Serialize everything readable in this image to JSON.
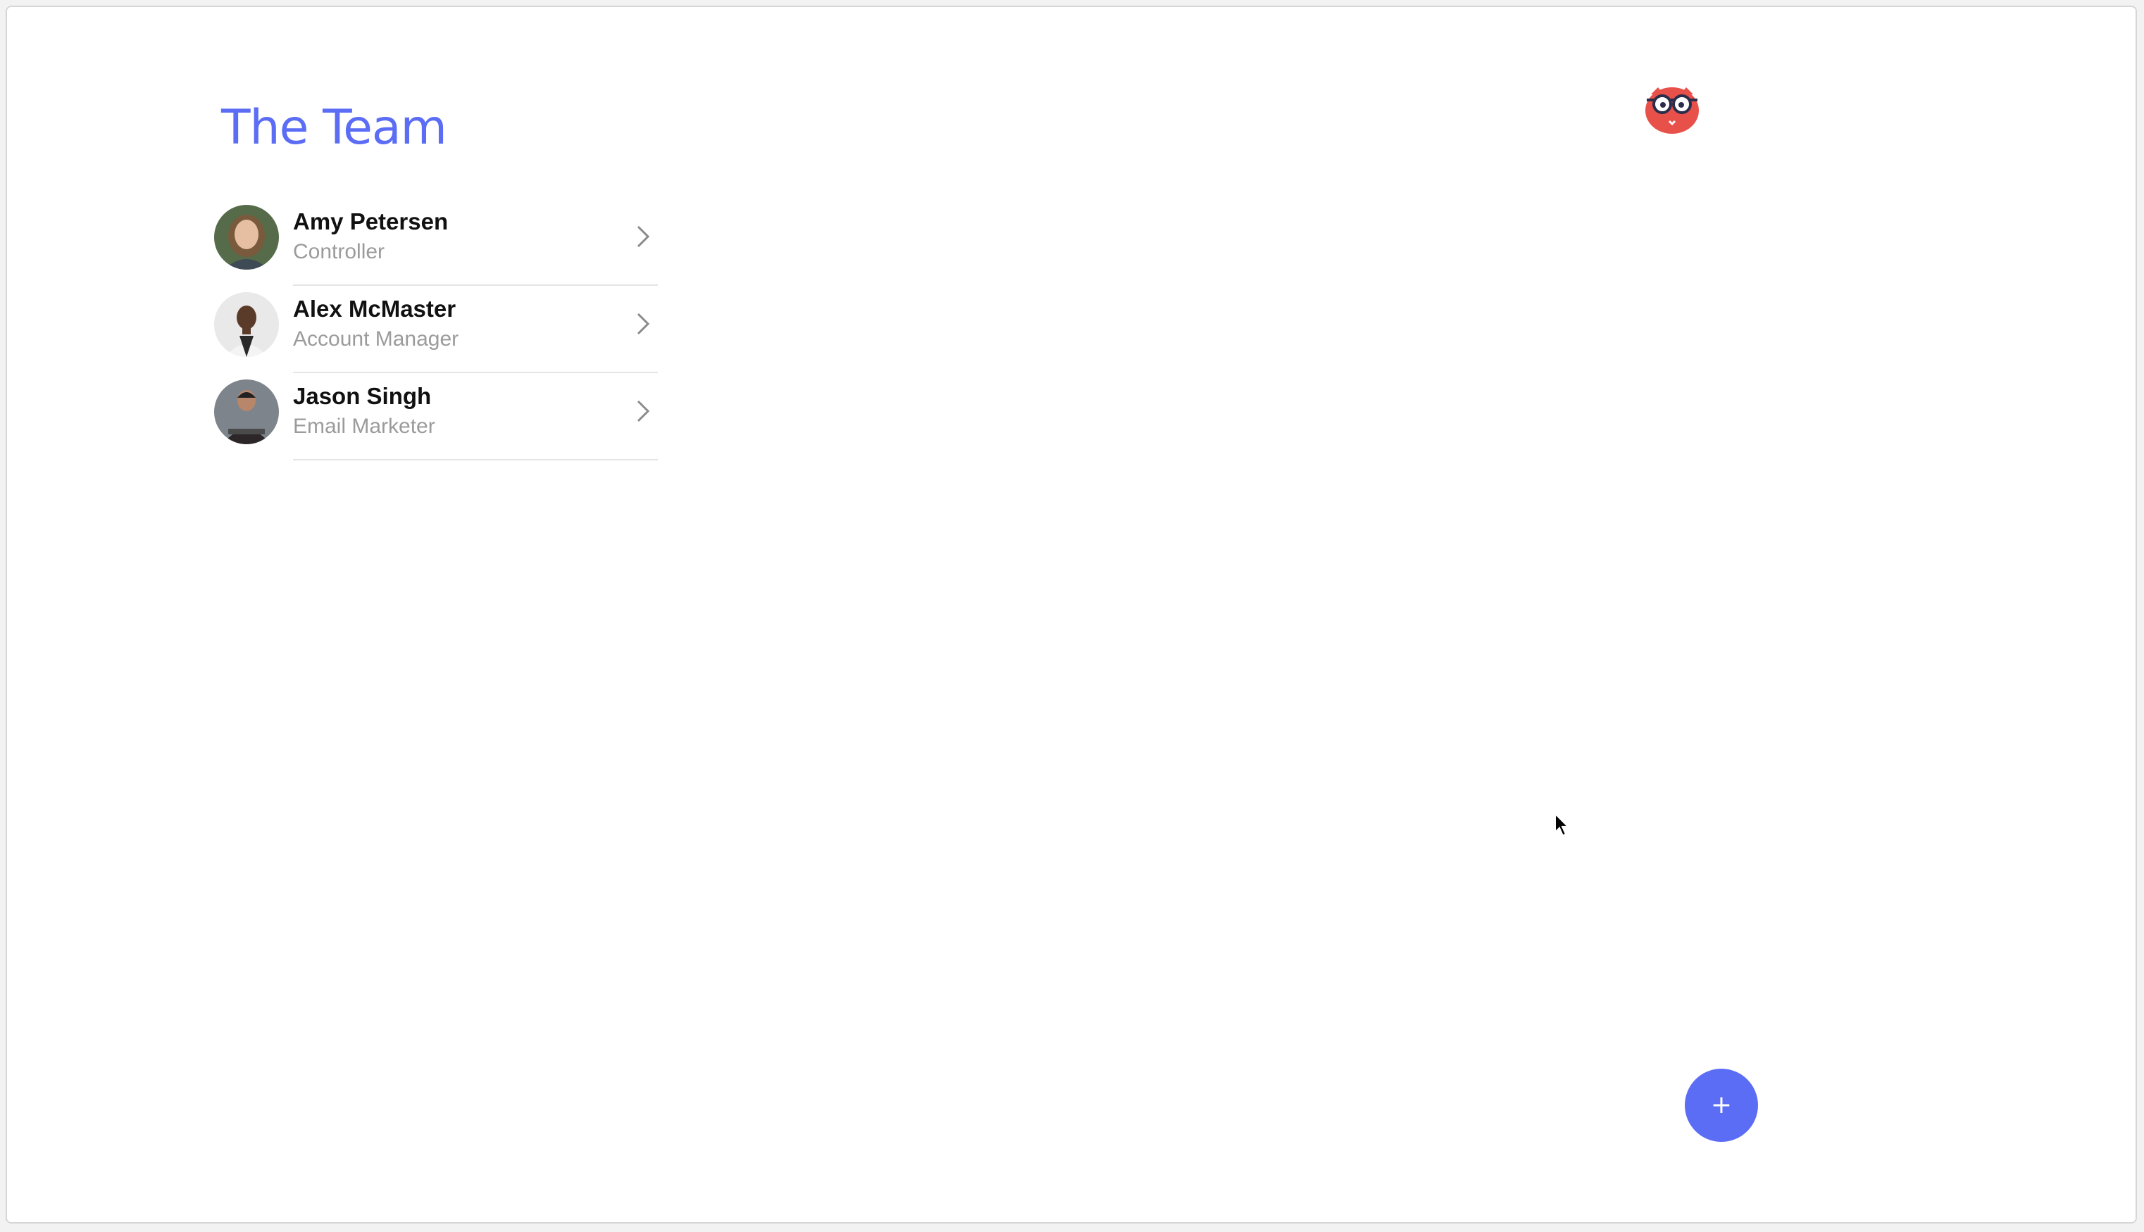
{
  "header": {
    "title": "The Team",
    "mascot_icon": "owl-mascot-icon"
  },
  "team": {
    "members": [
      {
        "name": "Amy Petersen",
        "role": "Controller"
      },
      {
        "name": "Alex McMaster",
        "role": "Account Manager"
      },
      {
        "name": "Jason Singh",
        "role": "Email Marketer"
      }
    ],
    "row_icon": "chevron-right-icon"
  },
  "fab": {
    "label": "+"
  },
  "colors": {
    "accent": "#5b6cf5",
    "mascot": "#e8504a",
    "name_text": "#111111",
    "role_text": "#9b9b9b",
    "divider": "#e4e4e4"
  }
}
